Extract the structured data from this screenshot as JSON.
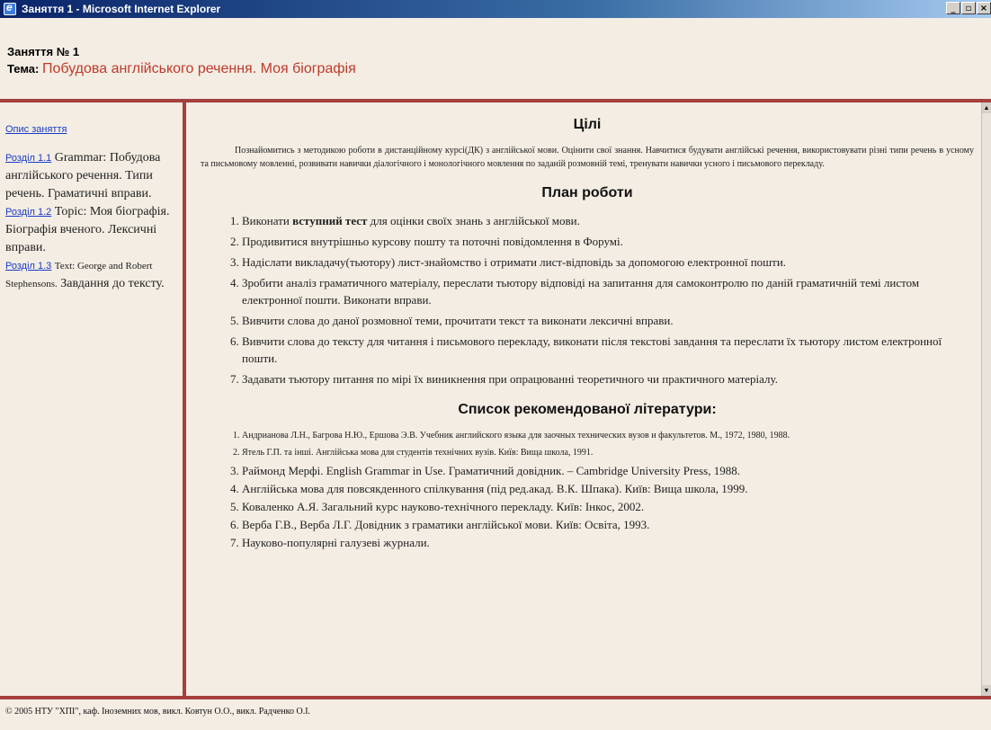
{
  "window": {
    "title": "Заняття 1 - Microsoft Internet Explorer",
    "buttons": [
      "_",
      "▫",
      "×"
    ]
  },
  "header": {
    "lesson": "Заняття № 1",
    "topic_label": "Тема:",
    "topic_value": "Побудова англійського речення. Моя біографія"
  },
  "sidebar": {
    "description_link": "Опис заняття",
    "sections": [
      {
        "link": "Розділ 1.1",
        "text": "Grammar: Побудова англійського речення. Типи речень. Граматичні вправи."
      },
      {
        "link": "Розділ 1.2",
        "text": "Topic: Моя біографія. Біографія вченого. Лексичні вправи."
      },
      {
        "link": "Розділ 1.3",
        "text_small": "Text: George and Robert Stephensons.",
        "text": "Завдання до тексту."
      }
    ]
  },
  "main": {
    "goals_title": "Цілі",
    "goals_text": "Познайомитись з методикою роботи в дистанційному курсі(ДК) з англійської мови. Оцінити свої знання. Навчитися будувати англійські речення, використовувати різні типи речень в усному та письмовому мовленні, розвивати навички діалогічного і монологічного мовлення по заданій розмовній темі, тренувати навички усного і письмового перекладу.",
    "plan_title": "План роботи",
    "plan": [
      {
        "pre": "Виконати ",
        "bold": "вступний тест",
        "post": " для оцінки своїх знань з англійської мови."
      },
      {
        "pre": "Продивитися внутрішньо курсову пошту та поточні повідомлення в Форумі.",
        "bold": "",
        "post": ""
      },
      {
        "pre": "Надіслати викладачу(тьютору) лист-знайомство і отримати лист-відповідь за допомогою електронної пошти.",
        "bold": "",
        "post": ""
      },
      {
        "pre": "Зробити аналіз граматичного матеріалу, переслати тьютору відповіді на запитання для самоконтролю по даній граматичній темі листом електронної пошти. Виконати вправи.",
        "bold": "",
        "post": ""
      },
      {
        "pre": "Вивчити слова до даної розмовної теми, прочитати текст та виконати лексичні вправи.",
        "bold": "",
        "post": ""
      },
      {
        "pre": "Вивчити слова до тексту для читання і письмового перекладу, виконати після текстові завдання та переслати їх тьютору листом електронної пошти.",
        "bold": "",
        "post": ""
      },
      {
        "pre": "Задавати тьютору питання по мірі їх виникнення при опрацюванні теоретичного чи практичного матеріалу.",
        "bold": "",
        "post": ""
      }
    ],
    "lit_title": "Список рекомендованої літератури:",
    "literature": [
      {
        "text": "Андрианова Л.Н., Багрова Н.Ю., Ершова Э.В. Учебник английского языка для заочных технических вузов и факультетов. М., 1972, 1980, 1988.",
        "size": "s"
      },
      {
        "text": "Ятель Г.П. та інші. Англійська мова для студентів технічних вузів. Київ: Вища школа, 1991.",
        "size": "s"
      },
      {
        "text": "Раймонд Мерфі. English Grammar in Use. Граматичний довідник. – Cambridge University Press, 1988.",
        "size": "b"
      },
      {
        "text": "Англійська мова для повсякденного спілкування (під ред.акад. В.К. Шпака). Київ: Вища школа, 1999.",
        "size": "b"
      },
      {
        "text": "Коваленко А.Я. Загальний курс науково-технічного перекладу. Київ: Інкос, 2002.",
        "size": "b"
      },
      {
        "text": "Верба Г.В., Верба Л.Г. Довідник з граматики англійської мови. Київ: Освіта, 1993.",
        "size": "b"
      },
      {
        "text": "Науково-популярні галузеві журнали.",
        "size": "b"
      }
    ]
  },
  "footer": {
    "text": "© 2005 НТУ \"ХПІ\", каф. Іноземних мов, викл. Ковтун О.О., викл. Радченко О.І."
  },
  "colors": {
    "frame_border": "#a63f3f",
    "topic": "#c0392b",
    "link": "#1a3cc7",
    "background": "#f3ede3"
  }
}
